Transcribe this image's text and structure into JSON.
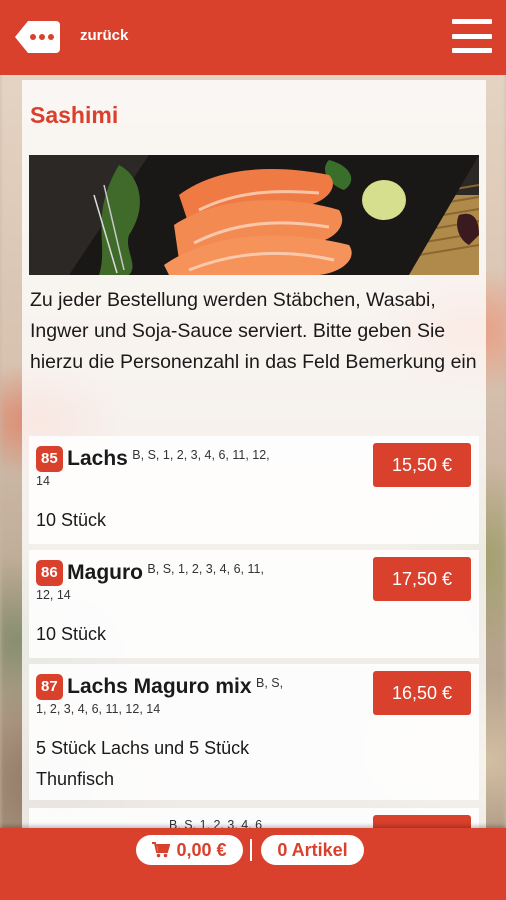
{
  "header": {
    "back_label": "zurück"
  },
  "section": {
    "title": "Sashimi",
    "intro": "Zu jeder Bestellung werden Stäbchen, Wasabi, Ingwer und Soja-Sauce serviert. Bitte geben Sie hierzu die Personenzahl in das Feld Bemerkung ein"
  },
  "items": [
    {
      "number": "85",
      "name": "Lachs",
      "allergens_a": "B, S, 1, 2, 3, 4, 6, 11, 12,",
      "allergens_b": "14",
      "description": "10 Stück",
      "price": "15,50 €"
    },
    {
      "number": "86",
      "name": "Maguro",
      "allergens_a": "B, S, 1, 2, 3, 4, 6, 11,",
      "allergens_b": "12, 14",
      "description": "10 Stück",
      "price": "17,50 €"
    },
    {
      "number": "87",
      "name": "Lachs Maguro mix",
      "allergens_a": "B, S,",
      "allergens_b": "1, 2, 3, 4, 6, 11, 12, 14",
      "description": "5 Stück Lachs und 5 Stück Thunfisch",
      "price": "16,50 €"
    }
  ],
  "partial_item": {
    "allergens_a": "B, S, 1, 2, 3, 4, 6"
  },
  "cart": {
    "total": "0,00 €",
    "count": "0 Artikel"
  },
  "colors": {
    "brand": "#d9412c"
  }
}
